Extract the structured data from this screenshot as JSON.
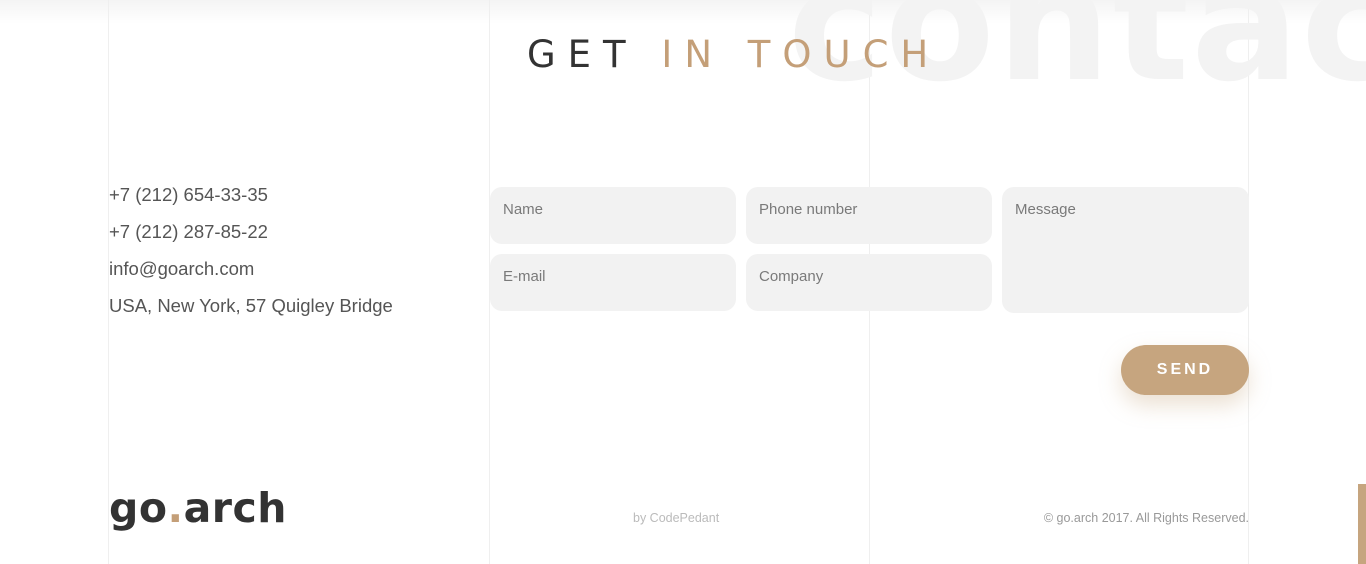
{
  "background_word": "contac",
  "heading": {
    "part1": "GET",
    "part2": "IN TOUCH"
  },
  "contact": {
    "phone1": "+7 (212) 654-33-35",
    "phone2": "+7 (212) 287-85-22",
    "email": "info@goarch.com",
    "address": "USA, New York, 57 Quigley Bridge"
  },
  "form": {
    "name_placeholder": "Name",
    "phone_placeholder": "Phone number",
    "message_placeholder": "Message",
    "email_placeholder": "E-mail",
    "company_placeholder": "Company",
    "send_label": "SEND"
  },
  "footer": {
    "logo_left": "go",
    "logo_dot": ".",
    "logo_right": "arch",
    "credit": "by CodePedant",
    "copyright": "© go.arch 2017. All Rights Reserved."
  },
  "colors": {
    "accent": "#c49f78",
    "button": "#c6a57f",
    "field_bg": "#f2f2f2",
    "heading_dark": "#333333"
  }
}
